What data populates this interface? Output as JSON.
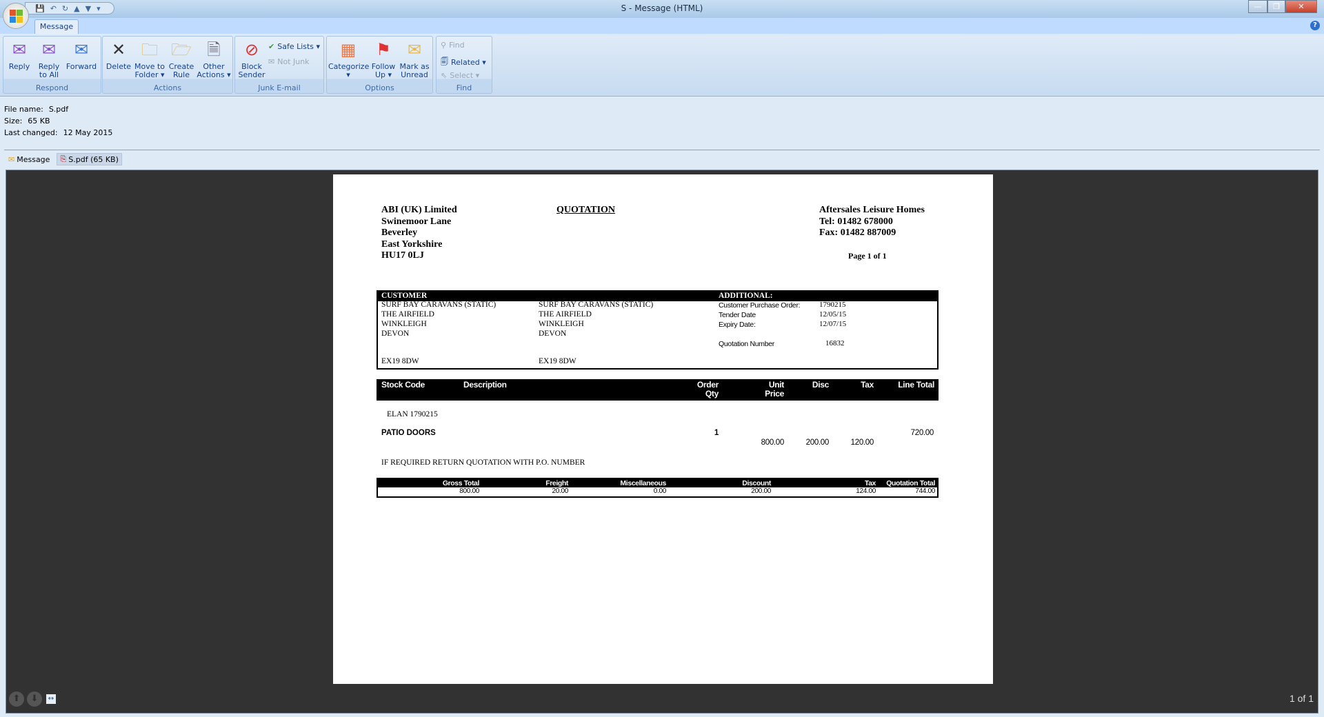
{
  "window": {
    "title": "S - Message (HTML)",
    "minimize": "—",
    "restore": "❐",
    "close": "✕"
  },
  "qat": {
    "save": "💾",
    "undo": "↶",
    "redo": "↻",
    "prev": "▲",
    "next": "▼",
    "customize": "▾"
  },
  "tabs": [
    {
      "label": "Message"
    }
  ],
  "help": "?",
  "ribbon": {
    "respond": {
      "label": "Respond",
      "reply": "Reply",
      "reply_all_1": "Reply",
      "reply_all_2": "to All",
      "forward": "Forward"
    },
    "actions": {
      "label": "Actions",
      "delete": "Delete",
      "move_1": "Move to",
      "move_2": "Folder ▾",
      "rule_1": "Create",
      "rule_2": "Rule",
      "other_1": "Other",
      "other_2": "Actions ▾"
    },
    "junk": {
      "label": "Junk E-mail",
      "block_1": "Block",
      "block_2": "Sender",
      "safe_lists": "Safe Lists ▾",
      "not_junk": "Not Junk"
    },
    "options": {
      "label": "Options",
      "categorize": "Categorize",
      "categorize_2": "▾",
      "follow_1": "Follow",
      "follow_2": "Up ▾",
      "mark_1": "Mark as",
      "mark_2": "Unread"
    },
    "find": {
      "label": "Find",
      "find": "Find",
      "related": "Related ▾",
      "select": "Select ▾"
    }
  },
  "file_info": {
    "name_label": "File name:",
    "name": "S.pdf",
    "size_label": "Size:",
    "size": "65 KB",
    "changed_label": "Last changed:",
    "changed": "12 May 2015"
  },
  "attachments": [
    {
      "label": "Message"
    },
    {
      "label": "S.pdf (65 KB)"
    }
  ],
  "document": {
    "sender": [
      "ABI (UK) Limited",
      "Swinemoor Lane",
      "Beverley",
      "East Yorkshire",
      "HU17 0LJ"
    ],
    "title": "QUOTATION",
    "company": [
      "Aftersales Leisure Homes",
      "Tel: 01482 678000",
      "Fax: 01482 887009"
    ],
    "page": "Page 1 of 1",
    "customer_label": "CUSTOMER",
    "additional_label": "ADDITIONAL:",
    "customer_1": [
      "SURF BAY CARAVANS (STATIC)",
      "THE AIRFIELD",
      "WINKLEIGH",
      "DEVON",
      "EX19 8DW"
    ],
    "customer_2": [
      "SURF BAY CARAVANS (STATIC)",
      "THE AIRFIELD",
      "WINKLEIGH",
      "DEVON",
      "EX19 8DW"
    ],
    "additional": [
      {
        "label": "Customer Purchase Order:",
        "value": "1790215"
      },
      {
        "label": "Tender Date",
        "value": "12/05/15"
      },
      {
        "label": "Expiry Date:",
        "value": "12/07/15"
      },
      {
        "label": "Quotation Number",
        "value": "16832"
      }
    ],
    "item_headers": {
      "stock_code": "Stock Code",
      "description": "Description",
      "qty_1": "Order",
      "qty_2": "Qty",
      "price_1": "Unit",
      "price_2": "Price",
      "disc": "Disc",
      "tax": "Tax",
      "line_total": "Line Total"
    },
    "reference": "ELAN 1790215",
    "items": [
      {
        "stock_code": "PATIO DOORS",
        "qty": "1",
        "unit_price": "800.00",
        "disc": "200.00",
        "tax": "120.00",
        "line_total": "720.00"
      }
    ],
    "note": "IF REQUIRED RETURN QUOTATION WITH P.O. NUMBER",
    "totals": {
      "headers": [
        "Gross Total",
        "Freight",
        "Miscellaneous",
        "Discount",
        "Tax",
        "Quotation Total"
      ],
      "values": [
        "800.00",
        "20.00",
        "0.00",
        "200.00",
        "124.00",
        "744.00"
      ]
    }
  },
  "viewer": {
    "page_count": "1 of 1",
    "prev": "⬆",
    "next": "⬇",
    "fit": "↔"
  }
}
